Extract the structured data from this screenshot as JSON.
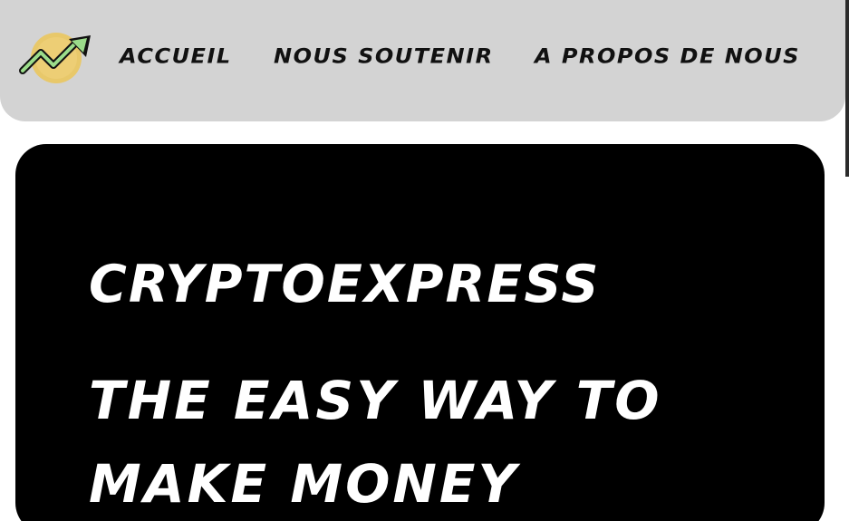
{
  "colors": {
    "navbar_background": "#d3d3d3",
    "hero_background": "#000000",
    "hero_text": "#ffffff",
    "nav_text": "#111111",
    "logo_coin": "#e8c86a",
    "logo_arrow": "#9bdc8a"
  },
  "navbar": {
    "logo_icon": "trend-up-coin-icon",
    "links": [
      {
        "label": "ACCUEIL"
      },
      {
        "label": "NOUS SOUTENIR"
      },
      {
        "label": "A PROPOS DE NOUS"
      }
    ]
  },
  "hero": {
    "title": "CRYPTOEXPRESS",
    "tagline": "THE EASY WAY TO MAKE MONEY"
  }
}
